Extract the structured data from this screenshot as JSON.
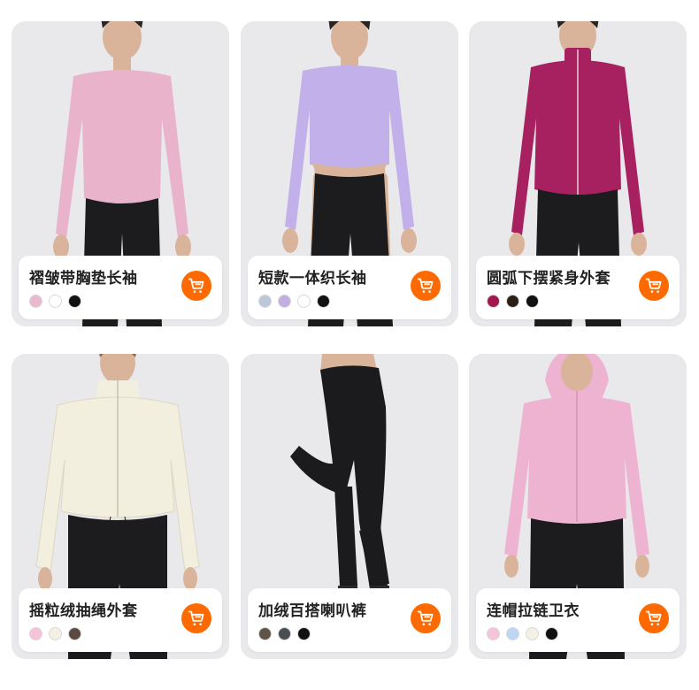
{
  "products": [
    {
      "title": "褶皱带胸垫长袖",
      "swatches": [
        "#eab9cf",
        "#ffffff",
        "#111111"
      ],
      "garment_color": "#e8b3cb",
      "icon": "cart-icon"
    },
    {
      "title": "短款一体织长袖",
      "swatches": [
        "#bcc8da",
        "#c4aee0",
        "#ffffff",
        "#111111"
      ],
      "garment_color": "#c2b0ea",
      "icon": "cart-icon"
    },
    {
      "title": "圆弧下摆紧身外套",
      "swatches": [
        "#a3174f",
        "#2e1f14",
        "#111111"
      ],
      "garment_color": "#a72060",
      "icon": "cart-icon"
    },
    {
      "title": "摇粒绒抽绳外套",
      "swatches": [
        "#f6c4da",
        "#f4f0e4",
        "#5a4a42"
      ],
      "garment_color": "#f3efdf",
      "icon": "cart-icon"
    },
    {
      "title": "加绒百搭喇叭裤",
      "swatches": [
        "#5f5446",
        "#4a4d52",
        "#111111"
      ],
      "garment_color": "#1b1b1d",
      "icon": "cart-icon"
    },
    {
      "title": "连帽拉链卫衣",
      "swatches": [
        "#f6c4da",
        "#bcd6f6",
        "#f4f0e4",
        "#111111"
      ],
      "garment_color": "#efb3d2",
      "icon": "cart-icon"
    }
  ],
  "colors": {
    "accent": "#ff6a00",
    "card_bg": "#e9e9ec"
  }
}
